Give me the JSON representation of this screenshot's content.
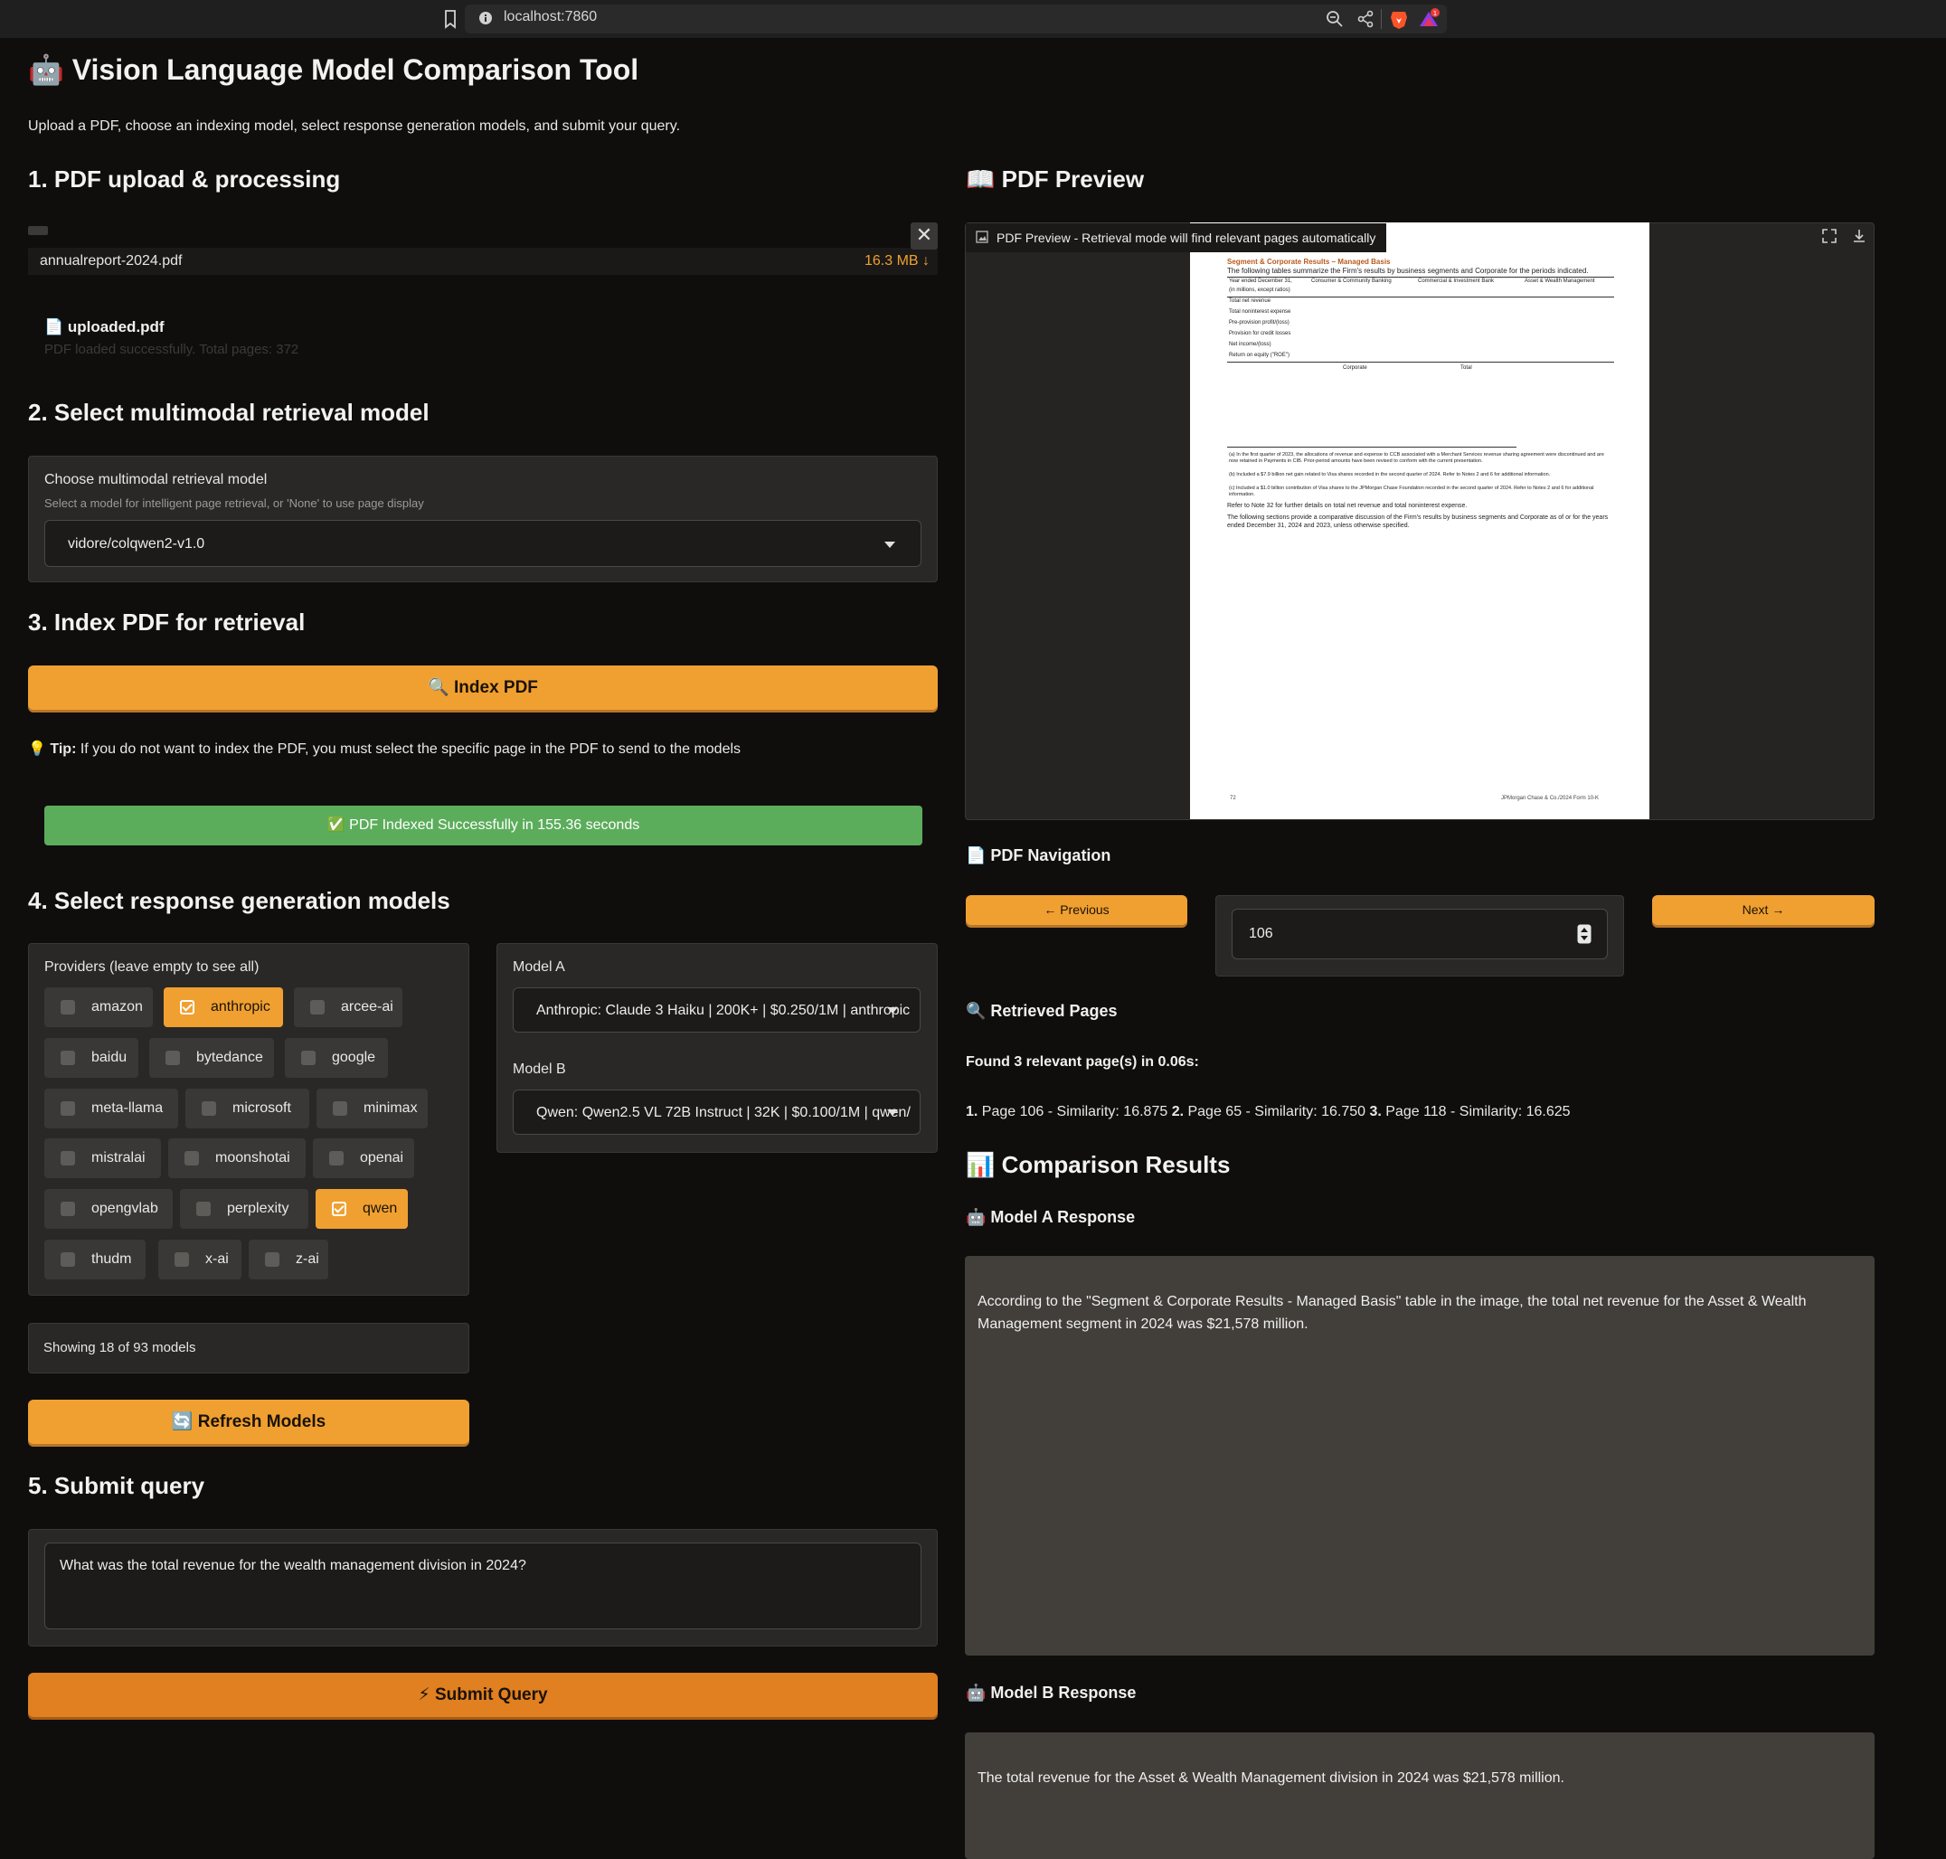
{
  "browser": {
    "url": "localhost:7860"
  },
  "header": {
    "title": "🤖 Vision Language Model Comparison Tool",
    "subtitle": "Upload a PDF, choose an indexing model, select response generation models, and submit your query."
  },
  "section1": {
    "heading": "1. PDF upload & processing",
    "file_name": "annualreport-2024.pdf",
    "file_size": "16.3 MB ↓",
    "uploaded_label": "📄 uploaded.pdf",
    "uploaded_status": "PDF loaded successfully. Total pages: 372"
  },
  "section2": {
    "heading": "2. Select multimodal retrieval model",
    "label": "Choose multimodal retrieval model",
    "hint": "Select a model for intelligent page retrieval, or 'None' to use page display",
    "selected": "vidore/colqwen2-v1.0"
  },
  "section3": {
    "heading": "3. Index PDF for retrieval",
    "index_button": "🔍 Index PDF",
    "tip_bold": "Tip:",
    "tip_text": " If you do not want to index the PDF, you must select the specific page in the PDF to send to the models",
    "tip_icon": "💡",
    "success": "✅ PDF Indexed Successfully in 155.36 seconds"
  },
  "section4": {
    "heading": "4. Select response generation models",
    "providers_label": "Providers (leave empty to see all)",
    "providers": [
      {
        "name": "amazon",
        "checked": false
      },
      {
        "name": "anthropic",
        "checked": true
      },
      {
        "name": "arcee-ai",
        "checked": false
      },
      {
        "name": "baidu",
        "checked": false
      },
      {
        "name": "bytedance",
        "checked": false
      },
      {
        "name": "google",
        "checked": false
      },
      {
        "name": "meta-llama",
        "checked": false
      },
      {
        "name": "microsoft",
        "checked": false
      },
      {
        "name": "minimax",
        "checked": false
      },
      {
        "name": "mistralai",
        "checked": false
      },
      {
        "name": "moonshotai",
        "checked": false
      },
      {
        "name": "openai",
        "checked": false
      },
      {
        "name": "opengvlab",
        "checked": false
      },
      {
        "name": "perplexity",
        "checked": false
      },
      {
        "name": "qwen",
        "checked": true
      },
      {
        "name": "thudm",
        "checked": false
      },
      {
        "name": "x-ai",
        "checked": false
      },
      {
        "name": "z-ai",
        "checked": false
      }
    ],
    "model_a_label": "Model A",
    "model_a_value": "Anthropic: Claude 3 Haiku | 200K+ | $0.250/1M | anthropic",
    "model_b_label": "Model B",
    "model_b_value": "Qwen: Qwen2.5 VL 72B Instruct | 32K | $0.100/1M | qwen/",
    "showing": "Showing 18 of 93 models",
    "refresh_button": "🔄 Refresh Models"
  },
  "section5": {
    "heading": "5. Submit query",
    "query": "What was the total revenue for the wealth management division in 2024?",
    "submit_button": "⚡ Submit Query"
  },
  "preview": {
    "heading": "📖 PDF Preview",
    "label": "PDF Preview - Retrieval mode will find relevant pages automatically",
    "page": {
      "head": "Segment & Corporate Results – Managed Basis",
      "sub": "The following tables summarize the Firm's results by business segments and Corporate for the periods indicated.",
      "col_groups": [
        "Consumer & Community Banking",
        "Commercial & Investment Bank",
        "Asset & Wealth Management"
      ],
      "rows": [
        "Year ended December 31,",
        "(in millions, except ratios)",
        "Total net revenue",
        "Total noninterest expense",
        "Pre-provision profit/(loss)",
        "Provision for credit losses",
        "Net income/(loss)",
        "Return on equity (\"ROE\")"
      ],
      "col_groups2": [
        "Corporate",
        "Total"
      ],
      "notes": [
        "(a) In the first quarter of 2023, the allocations of revenue and expense to CCB associated with a Merchant Services revenue sharing agreement were discontinued and are now retained in Payments in CIB. Prior-period amounts have been revised to conform with the current presentation.",
        "(b) Included a $7.9 billion net gain related to Visa shares recorded in the second quarter of 2024. Refer to Notes 2 and 6 for additional information.",
        "(c) Included a $1.0 billion contribution of Visa shares to the JPMorgan Chase Foundation recorded in the second quarter of 2024. Refer to Notes 2 and 6 for additional information.",
        "Refer to Note 32 for further details on total net revenue and total noninterest expense.",
        "The following sections provide a comparative discussion of the Firm's results by business segments and Corporate as of or for the years ended December 31, 2024 and 2023, unless otherwise specified."
      ],
      "footer_left": "72",
      "footer_right": "JPMorgan Chase & Co./2024 Form 10-K"
    }
  },
  "navigation": {
    "heading": "📄 PDF Navigation",
    "prev": "← Previous",
    "next": "Next →",
    "page_number": "106"
  },
  "retrieved": {
    "heading": "🔍 Retrieved Pages",
    "found": "Found 3 relevant page(s) in 0.06s:",
    "items": [
      {
        "num": "1.",
        "text": " Page 106 - Similarity: 16.875 "
      },
      {
        "num": "2.",
        "text": " Page 65 - Similarity: 16.750 "
      },
      {
        "num": "3.",
        "text": " Page 118 - Similarity: 16.625"
      }
    ]
  },
  "comparison": {
    "heading": "📊 Comparison Results",
    "model_a_heading": "🤖 Model A Response",
    "model_a_response": "According to the \"Segment & Corporate Results - Managed Basis\" table in the image, the total net revenue for the Asset & Wealth Management segment in 2024 was $21,578 million.",
    "model_b_heading": "🤖 Model B Response",
    "model_b_response": "The total revenue for the Asset & Wealth Management division in 2024 was $21,578 million."
  },
  "icons": {
    "bookmark": "bookmark-icon",
    "info": "info-icon",
    "zoom": "zoom-icon",
    "share": "share-icon",
    "brave": "brave-lion-icon",
    "rewards": "brave-rewards-icon",
    "fullscreen": "fullscreen-icon",
    "download": "download-icon",
    "image": "image-icon",
    "close": "close-icon",
    "spinner": "number-spinner-icon",
    "dropdown": "chevron-down-icon"
  },
  "colors": {
    "accent": "#f0a030",
    "submit": "#e08020",
    "success": "#5cad5b",
    "background": "#0f0e0d",
    "response_bg": "#423f3a"
  }
}
